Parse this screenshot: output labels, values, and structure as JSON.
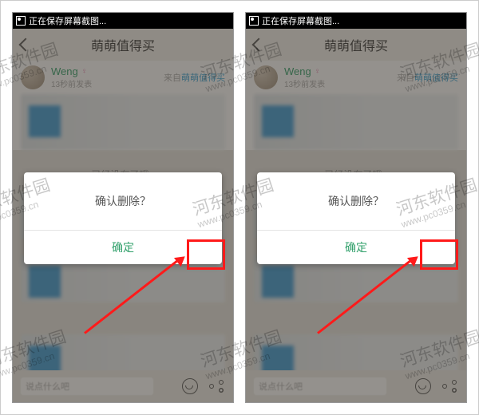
{
  "statusbar": {
    "saving_text": "正在保存屏幕截图..."
  },
  "navbar": {
    "title": "萌萌值得买"
  },
  "post": {
    "username": "Weng",
    "gender_symbol": "♀",
    "timestamp": "13秒前发表",
    "from_label": "来自",
    "from_app": "萌萌值得买"
  },
  "feed": {
    "no_more": "已经没有了哦~"
  },
  "dialog": {
    "message": "确认删除？",
    "confirm": "确定"
  },
  "bottombar": {
    "placeholder": "说点什么吧"
  },
  "watermark": {
    "name": "河东软件园",
    "url": "www.pc0359.cn"
  }
}
